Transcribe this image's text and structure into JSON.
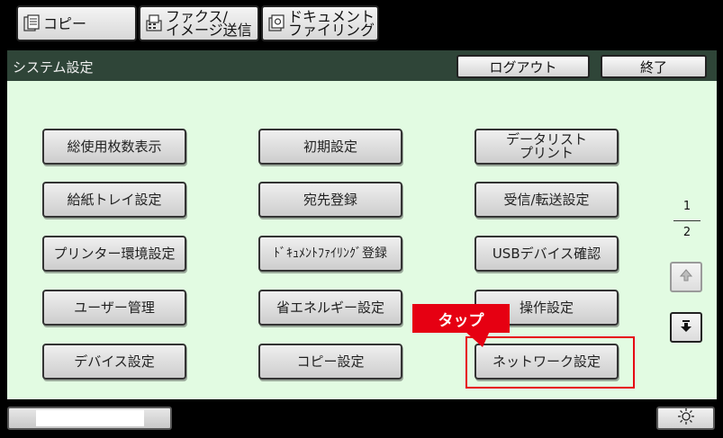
{
  "tabs": {
    "copy": "コピー",
    "fax": "ファクス/\nイメージ送信",
    "document": "ドキュメント\nファイリング"
  },
  "header": {
    "title": "システム設定",
    "logout": "ログアウト",
    "end": "終了"
  },
  "settings": {
    "total_count": "総使用枚数表示",
    "initial": "初期設定",
    "data_list": "データリスト\nプリント",
    "paper_tray": "給紙トレイ設定",
    "address_book": "宛先登録",
    "receive_forward": "受信/転送設定",
    "printer_env": "プリンター環境設定",
    "doc_filing_reg": "ﾄﾞｷｭﾒﾝﾄﾌｧｲﾘﾝｸﾞ登録",
    "usb_device": "USBデバイス確認",
    "user_mgmt": "ユーザー管理",
    "energy_save": "省エネルギー設定",
    "operation": "操作設定",
    "device": "デバイス設定",
    "copy_settings": "コピー設定",
    "network": "ネットワーク設定"
  },
  "pager": {
    "current": "1",
    "total": "2"
  },
  "annotation": {
    "tap": "タップ"
  },
  "colors": {
    "panel_bg": "#e2fbe2",
    "titlebar_bg": "#2f4538",
    "highlight": "#e60012"
  }
}
